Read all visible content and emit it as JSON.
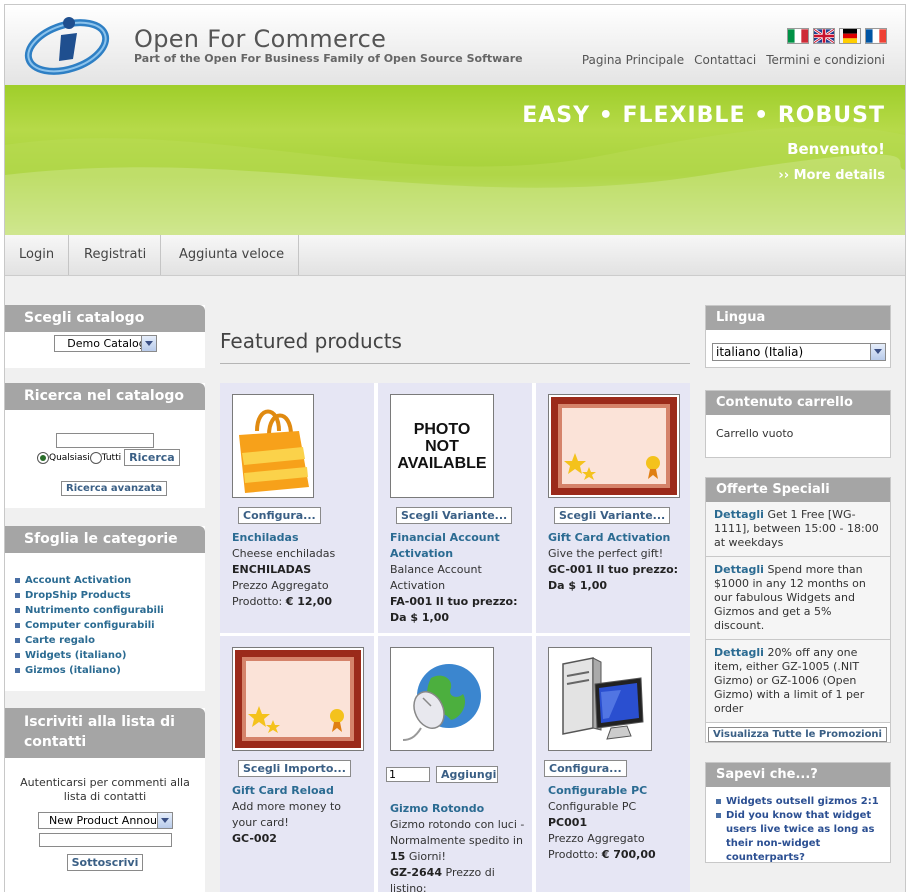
{
  "header": {
    "title": "Open For Commerce",
    "subtitle": "Part of the Open For Business Family of Open Source Software",
    "links": [
      "Pagina Principale",
      "Contattaci",
      "Termini e condizioni"
    ],
    "flags": [
      "flag-italy-icon",
      "flag-uk-icon",
      "flag-germany-icon",
      "flag-france-icon"
    ]
  },
  "banner": {
    "slogan": "EASY • FLEXIBLE • ROBUST",
    "welcome": "Benvenuto!",
    "more": "›› More details"
  },
  "nav": {
    "tabs": [
      "Login",
      "Registrati",
      "Aggiunta veloce"
    ]
  },
  "left": {
    "catalog": {
      "title": "Scegli catalogo",
      "selected": "Demo Catalog"
    },
    "search": {
      "title": "Ricerca nel catalogo",
      "opt_any": "Qualsiasi",
      "opt_all": "Tutti",
      "button": "Ricerca",
      "advanced": "Ricerca avanzata"
    },
    "categories": {
      "title": "Sfoglia le categorie",
      "items": [
        "Account Activation",
        "DropShip Products",
        "Nutrimento configurabili",
        "Computer configurabili",
        "Carte regalo",
        "Widgets (italiano)",
        "Gizmos (italiano)"
      ]
    },
    "newsletter": {
      "title": "Iscriviti alla lista di contatti",
      "note": "Autenticarsi per commenti alla lista di contatti",
      "selected": "New Product Announ",
      "button": "Sottoscrivi"
    }
  },
  "main": {
    "title": "Featured products",
    "products": [
      {
        "button": "Configura...",
        "name": "Enchiladas",
        "desc": "Cheese enchiladas",
        "code": "ENCHILADAS",
        "extra1": "Prezzo Aggregato",
        "price_label": "Prodotto:",
        "price": "€ 12,00"
      },
      {
        "button": "Scegli Variante...",
        "name": "Financial Account Activation",
        "desc": "Balance Account Activation",
        "code": "FA-001",
        "price_label": "Il tuo prezzo:",
        "price": "Da $ 1,00",
        "no_photo": "PHOTO NOT AVAILABLE"
      },
      {
        "button": "Scegli Variante...",
        "name": "Gift Card Activation",
        "desc": "Give the perfect gift!",
        "code": "GC-001",
        "price_label": "Il tuo prezzo:",
        "price": "Da $ 1,00"
      },
      {
        "button": "Scegli Importo...",
        "name": "Gift Card Reload",
        "desc": "Add more money to your card!",
        "code": "GC-002"
      },
      {
        "qty": "1",
        "button": "Aggiungi al carrello",
        "name": "Gizmo Rotondo",
        "desc1": "Gizmo rotondo con luci - Normalmente spedito in",
        "days": "15",
        "desc2": "Giorni!",
        "code": "GZ-2644",
        "price_label": "Prezzo di listino:"
      },
      {
        "button": "Configura...",
        "name": "Configurable PC",
        "desc": "Configurable PC",
        "code": "PC001",
        "extra1": "Prezzo Aggregato",
        "price_label": "Prodotto:",
        "price": "€ 700,00"
      }
    ]
  },
  "right": {
    "language": {
      "title": "Lingua",
      "selected": "italiano (Italia)"
    },
    "cart": {
      "title": "Contenuto carrello",
      "text": "Carrello vuoto"
    },
    "offers": {
      "title": "Offerte Speciali",
      "link": "Dettagli",
      "items": [
        "Get 1 Free [WG-1111], between 15:00 - 18:00 at weekdays",
        "Spend more than $1000 in any 12 months on our fabulous Widgets and Gizmos and get a 5% discount.",
        "20% off any one item, either GZ-1005 (.NIT Gizmo) or GZ-1006 (Open Gizmo) with a limit of 1 per order"
      ],
      "all_button": "Visualizza Tutte le Promozioni"
    },
    "know": {
      "title": "Sapevi che...?",
      "items": [
        "Widgets outsell gizmos 2:1",
        "Did you know that widget users live twice as long as their non-widget counterparts?"
      ]
    }
  },
  "colors": {
    "banner_green": "#a6d13a",
    "box_header": "#a5a5a5",
    "link_blue": "#2b6b92",
    "product_bg": "#e6e6f4"
  }
}
